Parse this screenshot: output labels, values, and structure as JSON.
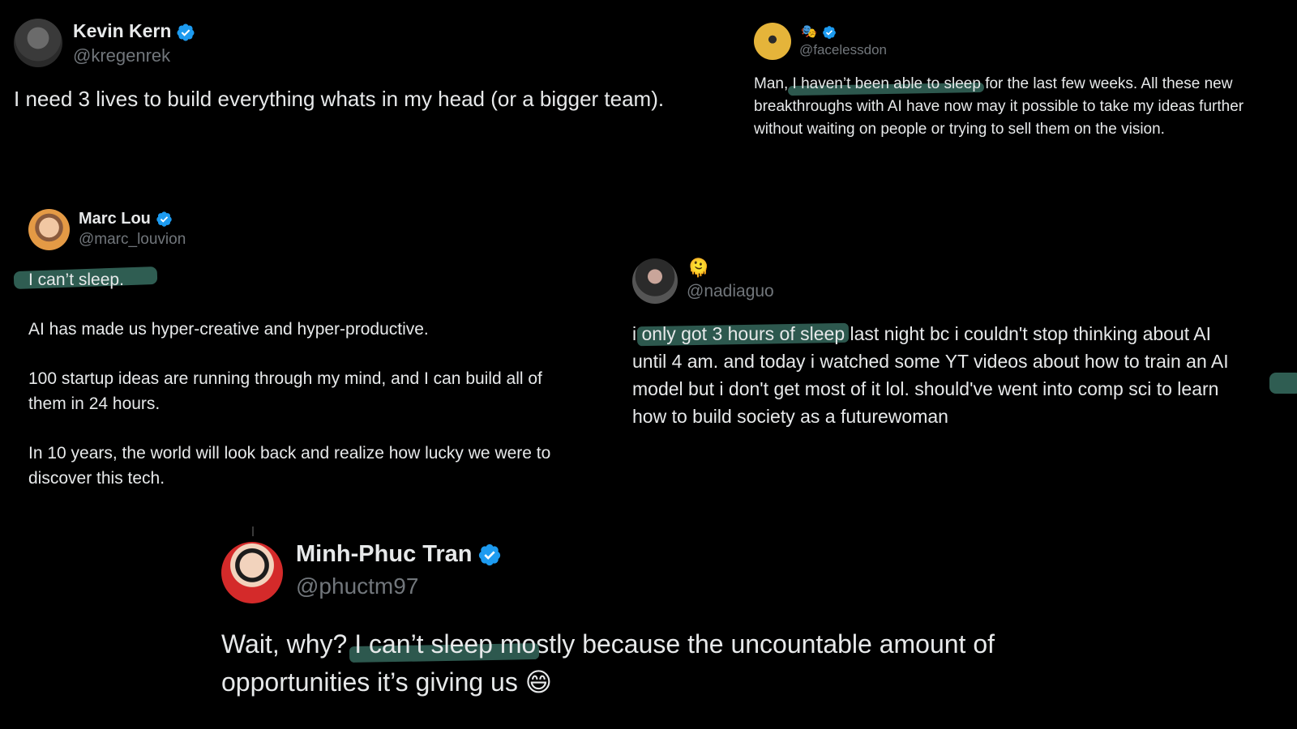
{
  "tweets": {
    "kevin": {
      "name": "Kevin Kern",
      "handle": "@kregenrek",
      "text": "I need 3 lives to build everything whats in my head (or a bigger team)."
    },
    "facelessdon": {
      "emojis": "🎭",
      "handle": "@facelessdon",
      "lead": "Man, ",
      "highlight": "I haven’t been able to sleep",
      "rest1": " for the last few weeks. All these new",
      "line2": "breakthroughs with AI have now may it possible to take my ideas further",
      "line3": "without waiting on people or trying to sell them on the vision."
    },
    "marc": {
      "name": "Marc Lou",
      "handle": "@marc_louvion",
      "highlight": "I can’t sleep.",
      "p1": "AI has made us hyper-creative and hyper-productive.",
      "p2a": "100 startup ideas are running through my mind, and I can build all of",
      "p2b": "them in 24 hours.",
      "p3a": "In 10 years, the world will look back and realize how lucky we were to",
      "p3b": "discover this tech."
    },
    "nadia": {
      "emoji": "🫠",
      "handle": "@nadiaguo",
      "lead": "i ",
      "highlight": "only got 3 hours of sleep",
      "rest1": " last night bc i couldn't stop thinking about AI",
      "line2": "until 4 am. and today i watched some YT videos about how to train an AI",
      "line3": "model but i don't get most of it lol. should've went into comp sci to learn",
      "line4": "how to build society as a futurewoman"
    },
    "minh": {
      "name": "Minh-Phuc Tran",
      "handle": "@phuctm97",
      "lead": "Wait, why? ",
      "highlight": "I can’t sleep mo",
      "rest1": "stly because the uncountable amount of",
      "line2": "opportunities it’s giving us 😄"
    }
  },
  "colors": {
    "background": "#000000",
    "text": "#e7e9ea",
    "handle": "#71767b",
    "verified": "#1d9bf0",
    "highlight": "#2f5d52"
  }
}
